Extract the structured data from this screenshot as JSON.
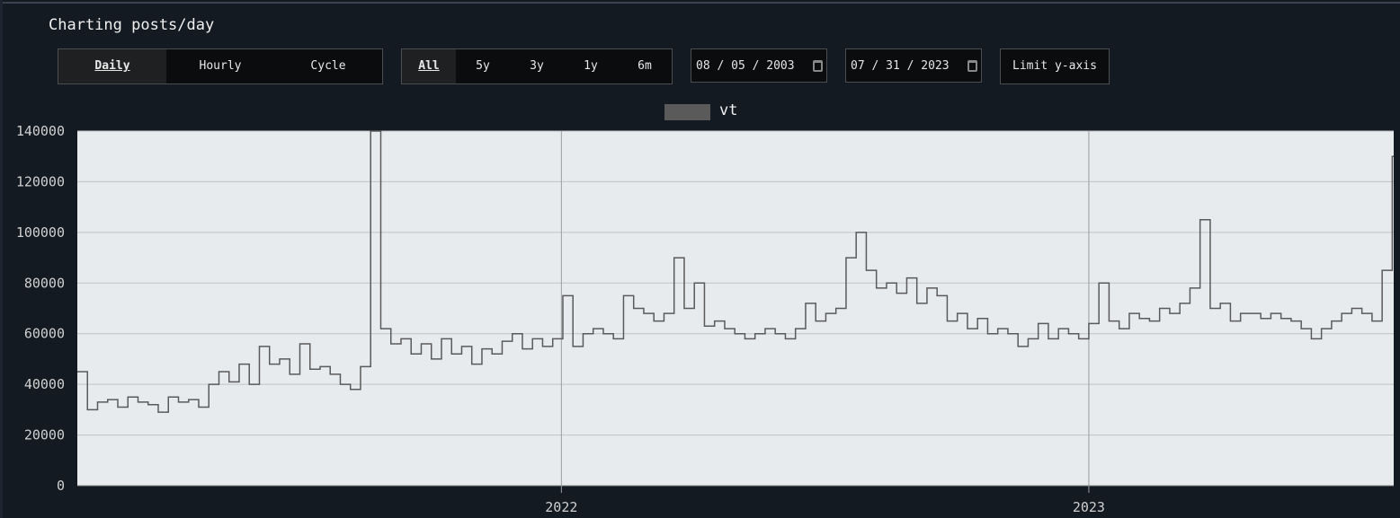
{
  "header": {
    "title": "Charting posts/day"
  },
  "mode_tabs": [
    {
      "label": "Daily",
      "active": true
    },
    {
      "label": "Hourly",
      "active": false
    },
    {
      "label": "Cycle",
      "active": false
    }
  ],
  "range_tabs": [
    {
      "label": "All",
      "active": true
    },
    {
      "label": "5y",
      "active": false
    },
    {
      "label": "3y",
      "active": false
    },
    {
      "label": "1y",
      "active": false
    },
    {
      "label": "6m",
      "active": false
    }
  ],
  "date_from": {
    "value": "08 / 05 / 2003"
  },
  "date_to": {
    "value": "07 / 31 / 2023"
  },
  "limit_button": {
    "label": "Limit y-axis"
  },
  "colors": {
    "background": "#131a22",
    "plot_bg": "#e8ebee",
    "series": "#5a5a5a"
  },
  "chart_data": {
    "type": "line",
    "step": true,
    "legend": {
      "position": "top",
      "entries": [
        "vt"
      ]
    },
    "series": [
      {
        "name": "vt",
        "color": "#5a5a5a",
        "points": [
          [
            "2021-01-31",
            45000
          ],
          [
            "2021-02-07",
            30000
          ],
          [
            "2021-02-14",
            33000
          ],
          [
            "2021-02-21",
            34000
          ],
          [
            "2021-02-28",
            31000
          ],
          [
            "2021-03-07",
            35000
          ],
          [
            "2021-03-14",
            33000
          ],
          [
            "2021-03-21",
            32000
          ],
          [
            "2021-03-28",
            29000
          ],
          [
            "2021-04-04",
            35000
          ],
          [
            "2021-04-11",
            33000
          ],
          [
            "2021-04-18",
            34000
          ],
          [
            "2021-04-25",
            31000
          ],
          [
            "2021-05-02",
            40000
          ],
          [
            "2021-05-09",
            45000
          ],
          [
            "2021-05-16",
            41000
          ],
          [
            "2021-05-23",
            48000
          ],
          [
            "2021-05-30",
            40000
          ],
          [
            "2021-06-06",
            55000
          ],
          [
            "2021-06-13",
            48000
          ],
          [
            "2021-06-20",
            50000
          ],
          [
            "2021-06-27",
            44000
          ],
          [
            "2021-07-04",
            56000
          ],
          [
            "2021-07-11",
            46000
          ],
          [
            "2021-07-18",
            47000
          ],
          [
            "2021-07-25",
            44000
          ],
          [
            "2021-08-01",
            40000
          ],
          [
            "2021-08-08",
            38000
          ],
          [
            "2021-08-15",
            47000
          ],
          [
            "2021-08-22",
            140000
          ],
          [
            "2021-08-29",
            62000
          ],
          [
            "2021-09-05",
            56000
          ],
          [
            "2021-09-12",
            58000
          ],
          [
            "2021-09-19",
            52000
          ],
          [
            "2021-09-26",
            56000
          ],
          [
            "2021-10-03",
            50000
          ],
          [
            "2021-10-10",
            58000
          ],
          [
            "2021-10-17",
            52000
          ],
          [
            "2021-10-24",
            55000
          ],
          [
            "2021-10-31",
            48000
          ],
          [
            "2021-11-07",
            54000
          ],
          [
            "2021-11-14",
            52000
          ],
          [
            "2021-11-21",
            57000
          ],
          [
            "2021-11-28",
            60000
          ],
          [
            "2021-12-05",
            54000
          ],
          [
            "2021-12-12",
            58000
          ],
          [
            "2021-12-19",
            55000
          ],
          [
            "2021-12-26",
            58000
          ],
          [
            "2022-01-02",
            75000
          ],
          [
            "2022-01-09",
            55000
          ],
          [
            "2022-01-16",
            60000
          ],
          [
            "2022-01-23",
            62000
          ],
          [
            "2022-01-30",
            60000
          ],
          [
            "2022-02-06",
            58000
          ],
          [
            "2022-02-13",
            75000
          ],
          [
            "2022-02-20",
            70000
          ],
          [
            "2022-02-27",
            68000
          ],
          [
            "2022-03-06",
            65000
          ],
          [
            "2022-03-13",
            68000
          ],
          [
            "2022-03-20",
            90000
          ],
          [
            "2022-03-27",
            70000
          ],
          [
            "2022-04-03",
            80000
          ],
          [
            "2022-04-10",
            63000
          ],
          [
            "2022-04-17",
            65000
          ],
          [
            "2022-04-24",
            62000
          ],
          [
            "2022-05-01",
            60000
          ],
          [
            "2022-05-08",
            58000
          ],
          [
            "2022-05-15",
            60000
          ],
          [
            "2022-05-22",
            62000
          ],
          [
            "2022-05-29",
            60000
          ],
          [
            "2022-06-05",
            58000
          ],
          [
            "2022-06-12",
            62000
          ],
          [
            "2022-06-19",
            72000
          ],
          [
            "2022-06-26",
            65000
          ],
          [
            "2022-07-03",
            68000
          ],
          [
            "2022-07-10",
            70000
          ],
          [
            "2022-07-17",
            90000
          ],
          [
            "2022-07-24",
            100000
          ],
          [
            "2022-07-31",
            85000
          ],
          [
            "2022-08-07",
            78000
          ],
          [
            "2022-08-14",
            80000
          ],
          [
            "2022-08-21",
            76000
          ],
          [
            "2022-08-28",
            82000
          ],
          [
            "2022-09-04",
            72000
          ],
          [
            "2022-09-11",
            78000
          ],
          [
            "2022-09-18",
            75000
          ],
          [
            "2022-09-25",
            65000
          ],
          [
            "2022-10-02",
            68000
          ],
          [
            "2022-10-09",
            62000
          ],
          [
            "2022-10-16",
            66000
          ],
          [
            "2022-10-23",
            60000
          ],
          [
            "2022-10-30",
            62000
          ],
          [
            "2022-11-06",
            60000
          ],
          [
            "2022-11-13",
            55000
          ],
          [
            "2022-11-20",
            58000
          ],
          [
            "2022-11-27",
            64000
          ],
          [
            "2022-12-04",
            58000
          ],
          [
            "2022-12-11",
            62000
          ],
          [
            "2022-12-18",
            60000
          ],
          [
            "2022-12-25",
            58000
          ],
          [
            "2023-01-01",
            64000
          ],
          [
            "2023-01-08",
            80000
          ],
          [
            "2023-01-15",
            65000
          ],
          [
            "2023-01-22",
            62000
          ],
          [
            "2023-01-29",
            68000
          ],
          [
            "2023-02-05",
            66000
          ],
          [
            "2023-02-12",
            65000
          ],
          [
            "2023-02-19",
            70000
          ],
          [
            "2023-02-26",
            68000
          ],
          [
            "2023-03-05",
            72000
          ],
          [
            "2023-03-12",
            78000
          ],
          [
            "2023-03-19",
            105000
          ],
          [
            "2023-03-26",
            70000
          ],
          [
            "2023-04-02",
            72000
          ],
          [
            "2023-04-09",
            65000
          ],
          [
            "2023-04-16",
            68000
          ],
          [
            "2023-04-23",
            68000
          ],
          [
            "2023-04-30",
            66000
          ],
          [
            "2023-05-07",
            68000
          ],
          [
            "2023-05-14",
            66000
          ],
          [
            "2023-05-21",
            65000
          ],
          [
            "2023-05-28",
            62000
          ],
          [
            "2023-06-04",
            58000
          ],
          [
            "2023-06-11",
            62000
          ],
          [
            "2023-06-18",
            65000
          ],
          [
            "2023-06-25",
            68000
          ],
          [
            "2023-07-02",
            70000
          ],
          [
            "2023-07-09",
            68000
          ],
          [
            "2023-07-16",
            65000
          ],
          [
            "2023-07-23",
            85000
          ],
          [
            "2023-07-30",
            130000
          ]
        ]
      }
    ],
    "xlim": [
      "2021-01-31",
      "2023-07-31"
    ],
    "xticks": [
      {
        "date": "2022-01-01",
        "label": "2022"
      },
      {
        "date": "2023-01-01",
        "label": "2023"
      }
    ],
    "ylim": [
      0,
      140000
    ],
    "yticks": [
      "0",
      "20000",
      "40000",
      "60000",
      "80000",
      "100000",
      "120000",
      "140000"
    ],
    "grid": true
  }
}
